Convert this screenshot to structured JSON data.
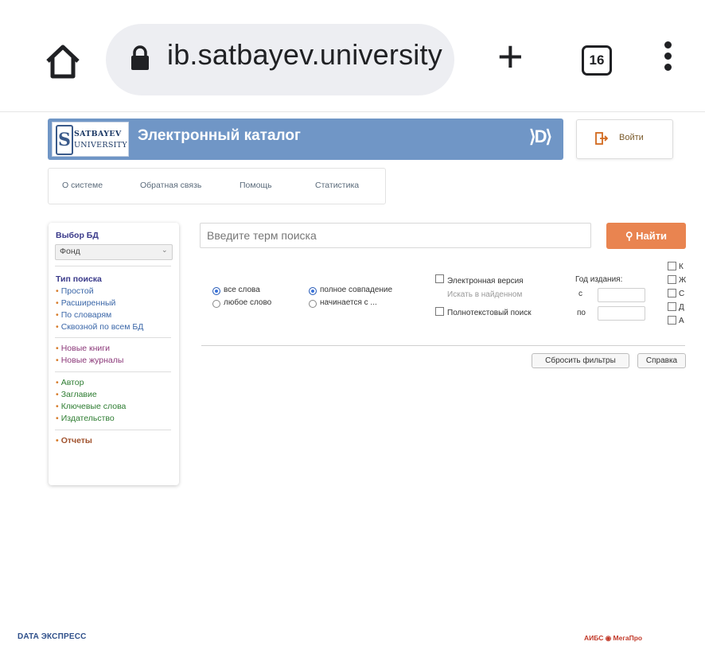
{
  "browser": {
    "url": "ib.satbayev.university",
    "tab_count": "16",
    "icons": [
      "home-icon",
      "lock-icon",
      "new-tab-icon",
      "tabs-icon",
      "kebab-menu-icon"
    ]
  },
  "header": {
    "logo_line1": "SATBAYEV",
    "logo_line2": "UNIVERSITY",
    "title": "Электронный каталог",
    "brand_mark": "D",
    "login_label": "Войти",
    "colors": {
      "banner": "#7096c6",
      "accent": "#e98450"
    }
  },
  "nav": {
    "items": [
      "О системе",
      "Обратная связь",
      "Помощь",
      "Статистика"
    ]
  },
  "sidebar": {
    "db_heading": "Выбор БД",
    "db_selected": "Фонд",
    "search_type_heading": "Тип поиска",
    "search_types": [
      "Простой",
      "Расширенный",
      "По словарям",
      "Сквозной по всем БД"
    ],
    "news": [
      "Новые книги",
      "Новые журналы"
    ],
    "fields": [
      "Автор",
      "Заглавие",
      "Ключевые слова",
      "Издательство"
    ],
    "reports": "Отчеты"
  },
  "search": {
    "placeholder": "Введите терм поиска",
    "button": "Найти"
  },
  "options": {
    "word_mode": [
      {
        "label": "все слова",
        "selected": true
      },
      {
        "label": "любое слово",
        "selected": false
      }
    ],
    "match_mode": [
      {
        "label": "полное совпадение",
        "selected": true
      },
      {
        "label": "начинается с ...",
        "selected": false
      }
    ],
    "checks": [
      "Электронная версия",
      "Искать в найденном",
      "Полнотекстовый поиск"
    ],
    "year_label": "Год издания:",
    "year_from": "с",
    "year_to": "по",
    "doc_types": [
      "К",
      "Ж",
      "С",
      "Д",
      "А"
    ]
  },
  "actions": {
    "reset": "Сбросить фильтры",
    "help": "Справка"
  },
  "footer": {
    "left": "DATA ЭКСПРЕСС",
    "right": "АИБС ◉ МегаПро"
  }
}
